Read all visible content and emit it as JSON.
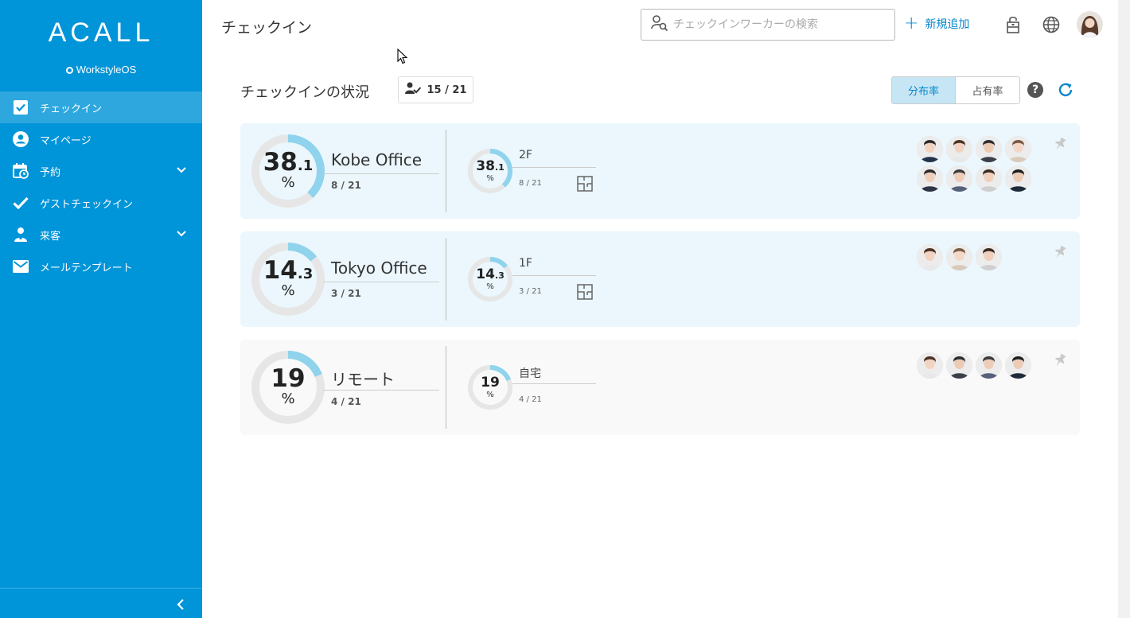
{
  "sidebar": {
    "logo": "ACALL",
    "logo_sub": "WorkstyleOS",
    "items": [
      {
        "label": "チェックイン",
        "icon": "checkbox-icon",
        "active": true
      },
      {
        "label": "マイページ",
        "icon": "account-icon"
      },
      {
        "label": "予約",
        "icon": "calendar-icon",
        "expandable": true
      },
      {
        "label": "ゲストチェックイン",
        "icon": "check-icon"
      },
      {
        "label": "来客",
        "icon": "visitor-icon",
        "expandable": true
      },
      {
        "label": "メールテンプレート",
        "icon": "mail-icon"
      }
    ]
  },
  "header": {
    "title": "チェックイン",
    "search_placeholder": "チェックインワーカーの検索",
    "add_label": "新規追加"
  },
  "status": {
    "title": "チェックインの状況",
    "count": "15 / 21",
    "toggle": [
      "分布率",
      "占有率"
    ],
    "active_toggle": "分布率",
    "help": "?"
  },
  "locations": [
    {
      "name": "Kobe Office",
      "pct_int": "38",
      "pct_dec": ".1",
      "pct_sign": "%",
      "fraction": 0.381,
      "count": "8 / 21",
      "floor": {
        "name": "2F",
        "pct_int": "38",
        "pct_dec": ".1",
        "pct_sign": "%",
        "fraction": 0.381,
        "count": "8 / 21",
        "has_map": true
      },
      "avatar_count": 8
    },
    {
      "name": "Tokyo Office",
      "pct_int": "14",
      "pct_dec": ".3",
      "pct_sign": "%",
      "fraction": 0.143,
      "count": "3 / 21",
      "floor": {
        "name": "1F",
        "pct_int": "14",
        "pct_dec": ".3",
        "pct_sign": "%",
        "fraction": 0.143,
        "count": "3 / 21",
        "has_map": true
      },
      "avatar_count": 3
    },
    {
      "name": "リモート",
      "pct_int": "19",
      "pct_dec": "",
      "pct_sign": "%",
      "fraction": 0.19,
      "count": "4 / 21",
      "floor": {
        "name": "自宅",
        "pct_int": "19",
        "pct_dec": "",
        "pct_sign": "%",
        "fraction": 0.19,
        "count": "4 / 21",
        "has_map": false
      },
      "avatar_count": 4
    }
  ],
  "colors": {
    "sidebar": "#0094d8",
    "accent": "#0a86cc",
    "ring_fill": "#8fd3ec",
    "ring_track": "#e6e6e6"
  }
}
